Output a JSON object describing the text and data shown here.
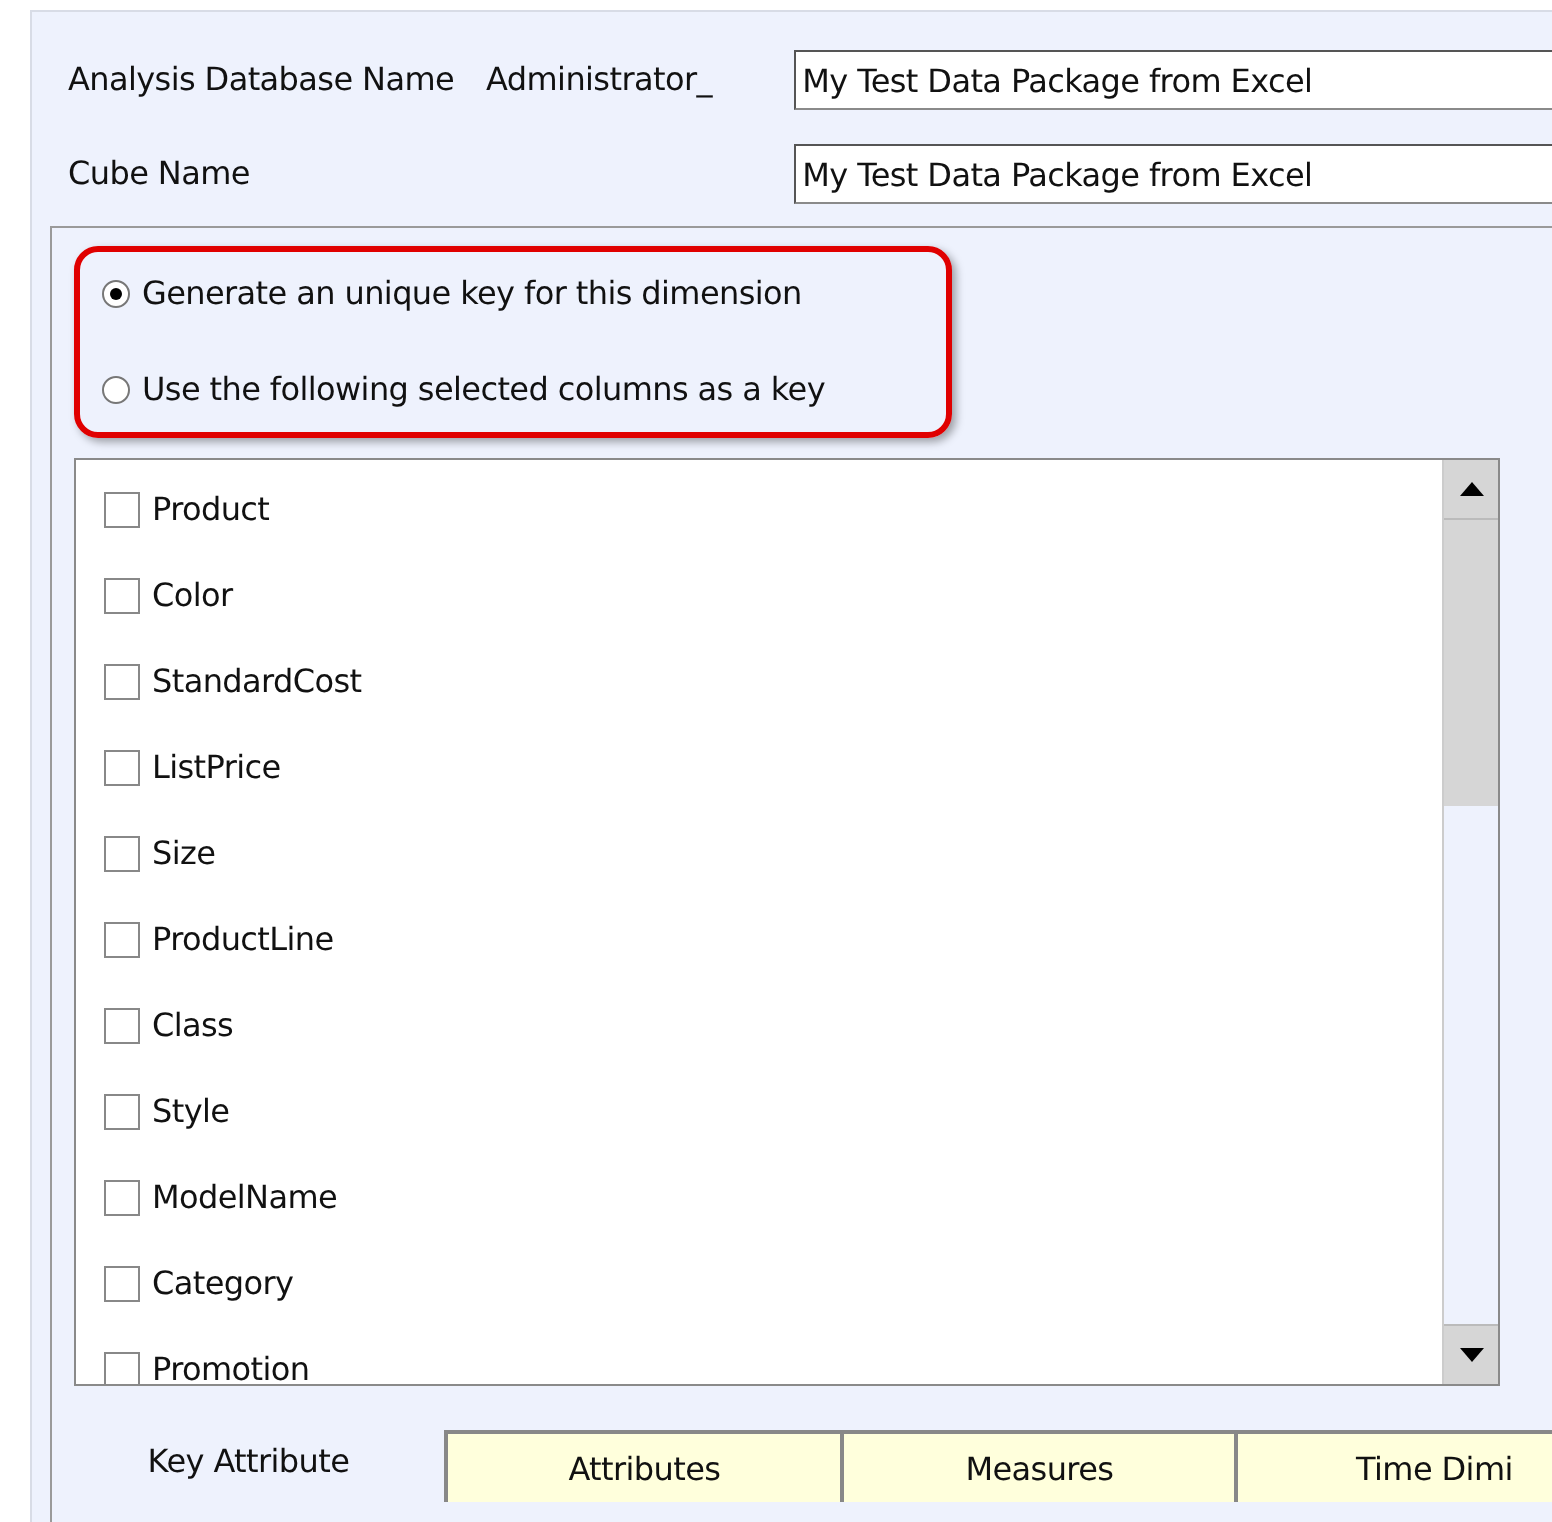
{
  "fields": [
    {
      "label": "Analysis Database Name",
      "suffix": "Administrator_",
      "value": "My Test Data Package from Excel"
    },
    {
      "label": "Cube Name",
      "value": "My Test Data Package from Excel"
    }
  ],
  "key_options": [
    {
      "label": "Generate an unique key for this dimension",
      "selected": true
    },
    {
      "label": "Use the following selected columns as a key",
      "selected": false
    }
  ],
  "columns": [
    {
      "label": "Product",
      "checked": false
    },
    {
      "label": "Color",
      "checked": false
    },
    {
      "label": "StandardCost",
      "checked": false
    },
    {
      "label": "ListPrice",
      "checked": false
    },
    {
      "label": "Size",
      "checked": false
    },
    {
      "label": "ProductLine",
      "checked": false
    },
    {
      "label": "Class",
      "checked": false
    },
    {
      "label": "Style",
      "checked": false
    },
    {
      "label": "ModelName",
      "checked": false
    },
    {
      "label": "Category",
      "checked": false
    },
    {
      "label": "Promotion",
      "checked": false
    }
  ],
  "tabs": [
    {
      "label": "Key Attribute",
      "selected": true
    },
    {
      "label": "Attributes",
      "selected": false
    },
    {
      "label": "Measures",
      "selected": false
    },
    {
      "label": "Time Dimi",
      "selected": false
    }
  ]
}
